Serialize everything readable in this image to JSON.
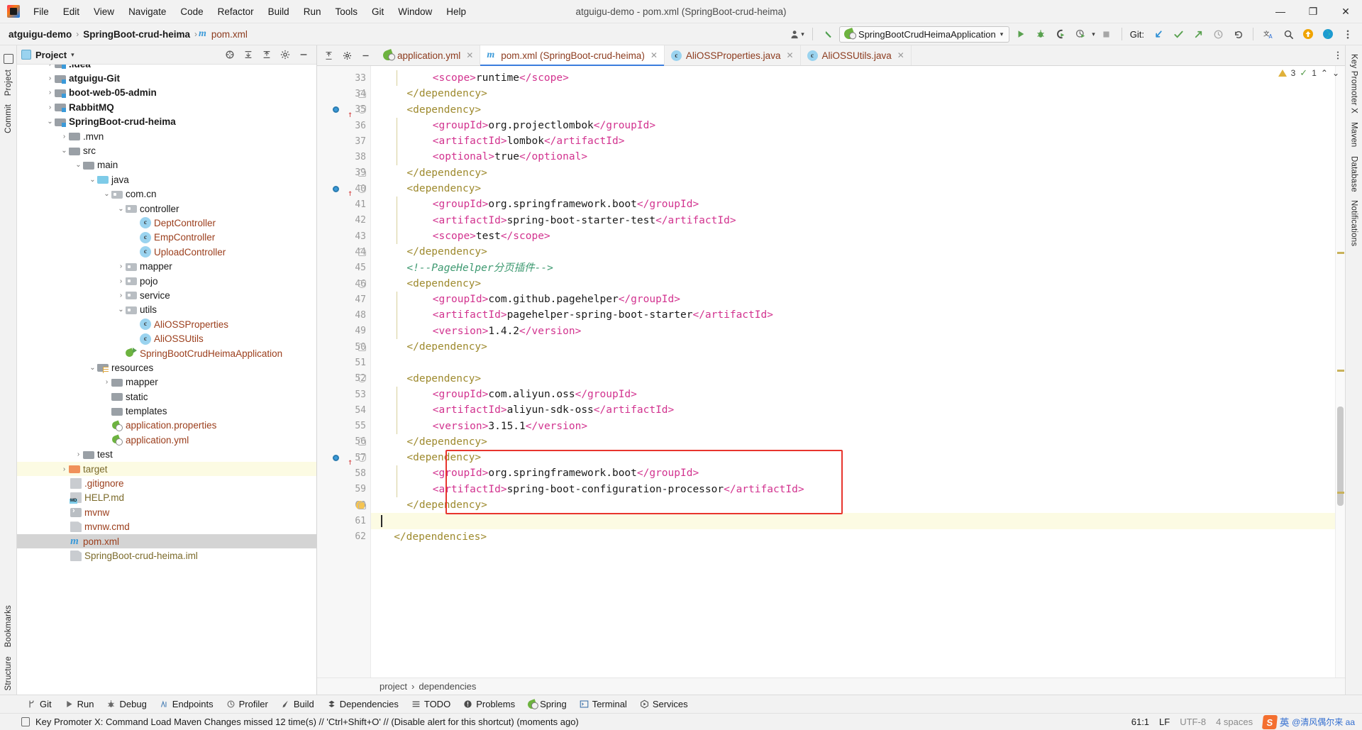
{
  "window": {
    "title": "atguigu-demo - pom.xml (SpringBoot-crud-heima)",
    "minimize": "—",
    "maximize": "❐",
    "close": "✕"
  },
  "menu": [
    {
      "label": "File"
    },
    {
      "label": "Edit"
    },
    {
      "label": "View"
    },
    {
      "label": "Navigate"
    },
    {
      "label": "Code"
    },
    {
      "label": "Refactor"
    },
    {
      "label": "Build"
    },
    {
      "label": "Run"
    },
    {
      "label": "Tools"
    },
    {
      "label": "Git"
    },
    {
      "label": "Window"
    },
    {
      "label": "Help"
    }
  ],
  "navbar": {
    "breadcrumbs": [
      "atguigu-demo",
      "SpringBoot-crud-heima",
      "pom.xml"
    ],
    "separator": "›",
    "run_config": "SpringBootCrudHeimaApplication",
    "git_label": "Git:",
    "icons": {
      "user": "user-avatar-icon",
      "back": "back-arrow-icon",
      "run": "run-icon",
      "debug": "debug-icon",
      "run_coverage": "run-with-coverage-icon",
      "profiler": "profiler-icon",
      "stop": "stop-icon",
      "update": "git-update-icon",
      "commit": "git-commit-icon",
      "push": "git-push-icon",
      "history": "git-history-icon",
      "rollback": "git-rollback-icon",
      "translate": "translate-icon",
      "search": "search-everywhere-icon",
      "notify": "notification-icon",
      "ide": "ide-feature-icon",
      "settings": "settings-icon",
      "more": "more-options-icon"
    }
  },
  "left_rail": [
    "Project",
    "Commit"
  ],
  "right_rail": [
    "Key Promoter X",
    "Maven",
    "Database",
    "Notifications"
  ],
  "bottom_rail": [
    "Bookmarks",
    "Structure"
  ],
  "project_panel": {
    "title": "Project",
    "dropdown_caret": "▾",
    "tree": [
      {
        "depth": 2,
        "arrow": "›",
        "icon": "folder-mod",
        "label": ".idea",
        "style": "bold",
        "clipped": true
      },
      {
        "depth": 2,
        "arrow": "›",
        "icon": "folder-mod",
        "label": "atguigu-Git",
        "style": "bold"
      },
      {
        "depth": 2,
        "arrow": "›",
        "icon": "folder-mod",
        "label": "boot-web-05-admin",
        "style": "bold"
      },
      {
        "depth": 2,
        "arrow": "›",
        "icon": "folder-mod",
        "label": "RabbitMQ",
        "style": "bold"
      },
      {
        "depth": 2,
        "arrow": "⌄",
        "icon": "folder-mod",
        "label": "SpringBoot-crud-heima",
        "style": "bold"
      },
      {
        "depth": 3,
        "arrow": "›",
        "icon": "folder",
        "label": ".mvn",
        "style": "dark"
      },
      {
        "depth": 3,
        "arrow": "⌄",
        "icon": "folder",
        "label": "src",
        "style": "dark"
      },
      {
        "depth": 4,
        "arrow": "⌄",
        "icon": "folder",
        "label": "main",
        "style": "dark"
      },
      {
        "depth": 5,
        "arrow": "⌄",
        "icon": "folder-blue",
        "label": "java",
        "style": "dark"
      },
      {
        "depth": 6,
        "arrow": "⌄",
        "icon": "folder-pkg",
        "label": "com.cn",
        "style": "dark"
      },
      {
        "depth": 7,
        "arrow": "⌄",
        "icon": "folder-pkg",
        "label": "controller",
        "style": "dark"
      },
      {
        "depth": 8,
        "arrow": "",
        "icon": "cls",
        "label": "DeptController",
        "style": "red"
      },
      {
        "depth": 8,
        "arrow": "",
        "icon": "cls",
        "label": "EmpController",
        "style": "red"
      },
      {
        "depth": 8,
        "arrow": "",
        "icon": "cls",
        "label": "UploadController",
        "style": "red"
      },
      {
        "depth": 7,
        "arrow": "›",
        "icon": "folder-pkg",
        "label": "mapper",
        "style": "dark"
      },
      {
        "depth": 7,
        "arrow": "›",
        "icon": "folder-pkg",
        "label": "pojo",
        "style": "dark"
      },
      {
        "depth": 7,
        "arrow": "›",
        "icon": "folder-pkg",
        "label": "service",
        "style": "dark"
      },
      {
        "depth": 7,
        "arrow": "⌄",
        "icon": "folder-pkg",
        "label": "utils",
        "style": "dark"
      },
      {
        "depth": 8,
        "arrow": "",
        "icon": "cls",
        "label": "AliOSSProperties",
        "style": "red"
      },
      {
        "depth": 8,
        "arrow": "",
        "icon": "cls",
        "label": "AliOSSUtils",
        "style": "red"
      },
      {
        "depth": 7,
        "arrow": "",
        "icon": "springrun",
        "label": "SpringBootCrudHeimaApplication",
        "style": "red"
      },
      {
        "depth": 5,
        "arrow": "⌄",
        "icon": "folder-res",
        "label": "resources",
        "style": "dark"
      },
      {
        "depth": 6,
        "arrow": "›",
        "icon": "folder",
        "label": "mapper",
        "style": "dark"
      },
      {
        "depth": 6,
        "arrow": "",
        "icon": "folder",
        "label": "static",
        "style": "dark"
      },
      {
        "depth": 6,
        "arrow": "",
        "icon": "folder",
        "label": "templates",
        "style": "dark"
      },
      {
        "depth": 6,
        "arrow": "",
        "icon": "spring",
        "label": "application.properties",
        "style": "red"
      },
      {
        "depth": 6,
        "arrow": "",
        "icon": "spring",
        "label": "application.yml",
        "style": "red"
      },
      {
        "depth": 4,
        "arrow": "›",
        "icon": "folder",
        "label": "test",
        "style": "dark"
      },
      {
        "depth": 3,
        "arrow": "›",
        "icon": "folder-orange",
        "label": "target",
        "style": "olive",
        "row": "yellow"
      },
      {
        "depth": 3,
        "arrow": "",
        "icon": "gitign",
        "label": ".gitignore",
        "style": "red"
      },
      {
        "depth": 3,
        "arrow": "",
        "icon": "md",
        "label": "HELP.md",
        "style": "olive"
      },
      {
        "depth": 3,
        "arrow": "",
        "icon": "sh",
        "label": "mvnw",
        "style": "red"
      },
      {
        "depth": 3,
        "arrow": "",
        "icon": "file",
        "label": "mvnw.cmd",
        "style": "red"
      },
      {
        "depth": 3,
        "arrow": "",
        "icon": "mico",
        "label": "pom.xml",
        "style": "red",
        "row": "selected"
      },
      {
        "depth": 3,
        "arrow": "",
        "icon": "iml",
        "label": "SpringBoot-crud-heima.iml",
        "style": "olive"
      }
    ]
  },
  "editor": {
    "tabs": [
      {
        "label": "application.yml",
        "icon": "spring-icon",
        "active": false,
        "closable": true
      },
      {
        "label": "pom.xml (SpringBoot-crud-heima)",
        "icon": "maven-icon",
        "active": true,
        "closable": true
      },
      {
        "label": "AliOSSProperties.java",
        "icon": "class-icon",
        "active": false,
        "closable": true
      },
      {
        "label": "AliOSSUtils.java",
        "icon": "class-icon",
        "active": false,
        "closable": true
      }
    ],
    "inspection": {
      "warnings": "3",
      "typos": "1",
      "chevron_up": "⌃",
      "chevron_down": "⌄"
    },
    "breadcrumb": [
      "project",
      "dependencies"
    ],
    "breadcrumb_sep": "›",
    "first_line": 33,
    "lines": [
      {
        "n": 33,
        "indent": 8,
        "text": "<scope>runtime</scope>",
        "bar": true
      },
      {
        "n": 34,
        "indent": 4,
        "text": "</dependency>",
        "fold": "close"
      },
      {
        "n": 35,
        "indent": 4,
        "text": "<dependency>",
        "fold": "open",
        "run": true
      },
      {
        "n": 36,
        "indent": 8,
        "text": "<groupId>org.projectlombok</groupId>",
        "bar": true
      },
      {
        "n": 37,
        "indent": 8,
        "text": "<artifactId>lombok</artifactId>",
        "bar": true
      },
      {
        "n": 38,
        "indent": 8,
        "text": "<optional>true</optional>",
        "bar": true
      },
      {
        "n": 39,
        "indent": 4,
        "text": "</dependency>",
        "fold": "close"
      },
      {
        "n": 40,
        "indent": 4,
        "text": "<dependency>",
        "fold": "open",
        "run": true
      },
      {
        "n": 41,
        "indent": 8,
        "text": "<groupId>org.springframework.boot</groupId>",
        "bar": true
      },
      {
        "n": 42,
        "indent": 8,
        "text": "<artifactId>spring-boot-starter-test</artifactId>",
        "bar": true
      },
      {
        "n": 43,
        "indent": 8,
        "text": "<scope>test</scope>",
        "bar": true
      },
      {
        "n": 44,
        "indent": 4,
        "text": "</dependency>",
        "fold": "close"
      },
      {
        "n": 45,
        "indent": 4,
        "text": "<!--PageHelper分页插件-->",
        "comment": true
      },
      {
        "n": 46,
        "indent": 4,
        "text": "<dependency>",
        "fold": "open"
      },
      {
        "n": 47,
        "indent": 8,
        "text": "<groupId>com.github.pagehelper</groupId>",
        "bar": true
      },
      {
        "n": 48,
        "indent": 8,
        "text": "<artifactId>pagehelper-spring-boot-starter</artifactId>",
        "bar": true
      },
      {
        "n": 49,
        "indent": 8,
        "text": "<version>1.4.2</version>",
        "bar": true,
        "squiggle": true
      },
      {
        "n": 50,
        "indent": 4,
        "text": "</dependency>",
        "fold": "close"
      },
      {
        "n": 51,
        "indent": 0,
        "text": ""
      },
      {
        "n": 52,
        "indent": 4,
        "text": "<dependency>",
        "fold": "open"
      },
      {
        "n": 53,
        "indent": 8,
        "text": "<groupId>com.aliyun.oss</groupId>",
        "bar": true
      },
      {
        "n": 54,
        "indent": 8,
        "text": "<artifactId>aliyun-sdk-oss</artifactId>",
        "bar": true
      },
      {
        "n": 55,
        "indent": 8,
        "text": "<version>3.15.1</version>",
        "bar": true,
        "squiggle": true
      },
      {
        "n": 56,
        "indent": 4,
        "text": "</dependency>",
        "fold": "close"
      },
      {
        "n": 57,
        "indent": 4,
        "text": "<dependency>",
        "fold": "open",
        "run": true,
        "boxed": true
      },
      {
        "n": 58,
        "indent": 8,
        "text": "<groupId>org.springframework.boot</groupId>",
        "bar": true,
        "boxed": true
      },
      {
        "n": 59,
        "indent": 8,
        "text": "<artifactId>spring-boot-configuration-processor</artifactId>",
        "bar": true,
        "boxed": true
      },
      {
        "n": 60,
        "indent": 4,
        "text": "</dependency>",
        "fold": "close",
        "bulb": true,
        "boxed": true
      },
      {
        "n": 61,
        "indent": 0,
        "text": "",
        "highlight": true,
        "caret": true
      },
      {
        "n": 62,
        "indent": 2,
        "text": "</dependencies>"
      }
    ]
  },
  "tool_windows": [
    {
      "label": "Git",
      "icon": "git-branch-icon"
    },
    {
      "label": "Run",
      "icon": "run-icon"
    },
    {
      "label": "Debug",
      "icon": "debug-icon"
    },
    {
      "label": "Endpoints",
      "icon": "endpoints-icon"
    },
    {
      "label": "Profiler",
      "icon": "profiler-icon"
    },
    {
      "label": "Build",
      "icon": "build-hammer-icon"
    },
    {
      "label": "Dependencies",
      "icon": "dependencies-icon"
    },
    {
      "label": "TODO",
      "icon": "todo-list-icon"
    },
    {
      "label": "Problems",
      "icon": "problems-icon"
    },
    {
      "label": "Spring",
      "icon": "spring-leaf-icon"
    },
    {
      "label": "Terminal",
      "icon": "terminal-icon"
    },
    {
      "label": "Services",
      "icon": "services-icon"
    }
  ],
  "status_bar": {
    "message": "Key Promoter X: Command Load Maven Changes missed 12 time(s) // 'Ctrl+Shift+O' // (Disable alert for this shortcut) (moments ago)",
    "caret_position": "61:1",
    "line_separator": "LF",
    "encoding": "UTF-8",
    "indent": "4 spaces",
    "watermark_ime": "英",
    "watermark_text": "@清风偶尔来 aa"
  },
  "colors": {
    "accent_blue": "#3b7ddd",
    "tag": "#9e8a2e",
    "attr": "#d2338f",
    "comment": "#3d9970",
    "error_box": "#e8352d",
    "highlight_row": "#fcfbe3",
    "spring_green": "#6db33f"
  }
}
